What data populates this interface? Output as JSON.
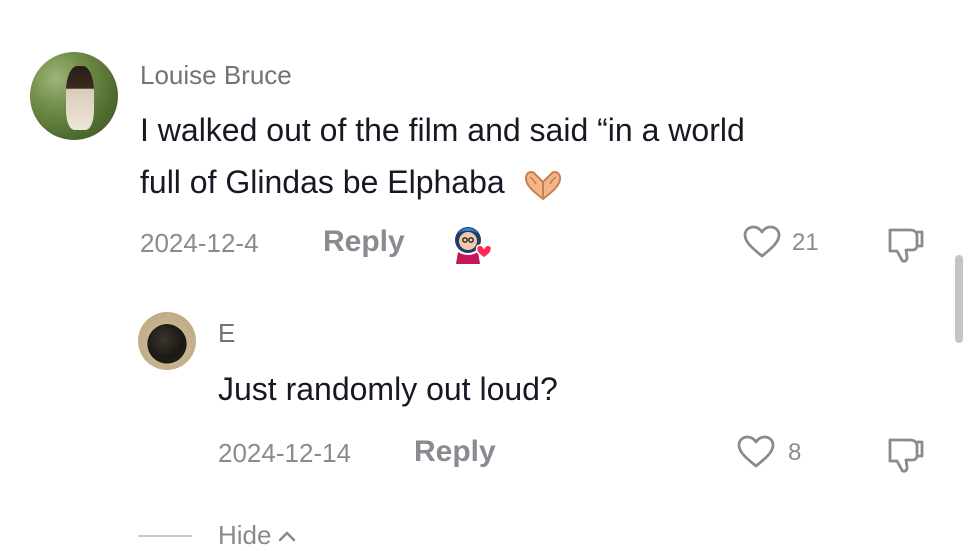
{
  "comments": [
    {
      "username": "Louise Bruce",
      "text_line1": "I walked out of the film and said “in a world",
      "text_line2": "full of Glindas be Elphaba",
      "emoji": "heart-hands-emoji",
      "date": "2024-12-4",
      "reply_label": "Reply",
      "like_count": "21",
      "creator_liked": true
    },
    {
      "username": "E",
      "text": "Just randomly out loud?",
      "date": "2024-12-14",
      "reply_label": "Reply",
      "like_count": "8"
    }
  ],
  "replies_toggle": {
    "label": "Hide"
  },
  "icons": {
    "like": "heart-outline-icon",
    "dislike": "thumbs-down-icon",
    "collapse": "chevron-up-icon",
    "creator_badge": "creator-liked-badge"
  },
  "colors": {
    "text_primary": "#161823",
    "text_secondary": "#8a8b91",
    "badge_heart": "#fe2c55"
  }
}
